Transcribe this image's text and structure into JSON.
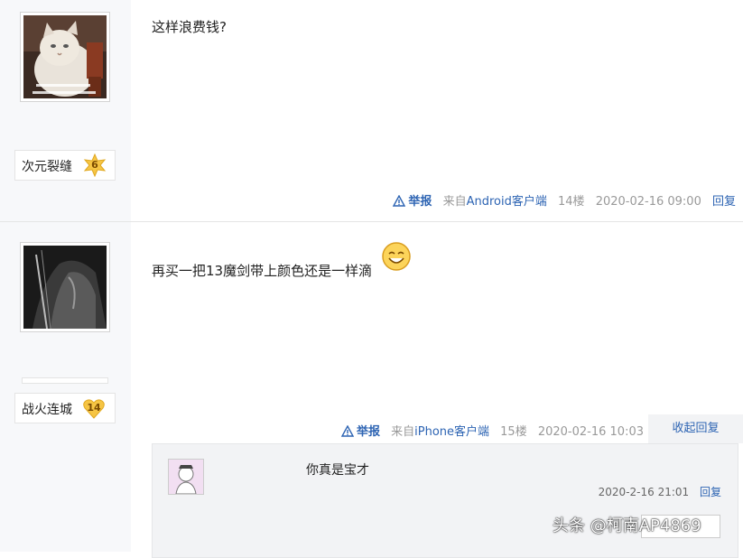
{
  "posts": [
    {
      "user": {
        "name": "次元裂缝",
        "level": "6"
      },
      "content": "这样浪费钱?",
      "meta": {
        "report": "举报",
        "source": "来自",
        "source_link": "Android客户端",
        "floor": "14楼",
        "time": "2020-02-16 09:00",
        "reply": "回复"
      }
    },
    {
      "user": {
        "name": "战火连城",
        "level": "14"
      },
      "content": "再买一把13魔剑带上颜色还是一样滴",
      "meta": {
        "report": "举报",
        "source": "来自",
        "source_link": "iPhone客户端",
        "floor": "15楼",
        "time": "2020-02-16 10:03",
        "collapse": "收起回复"
      },
      "replies": [
        {
          "text": "你真是宝才",
          "time": "2020-2-16 21:01",
          "reply": "回复"
        }
      ]
    }
  ],
  "watermark": "头条 @柯南AP4869",
  "colors": {
    "link": "#2d64b3",
    "sidebar_bg": "#f7f8fa",
    "reply_bg": "#f2f3f5"
  },
  "icons": [
    "warning-triangle-icon",
    "level-star-badge-icon",
    "level-heart-badge-icon",
    "smiley-emoji-icon"
  ]
}
